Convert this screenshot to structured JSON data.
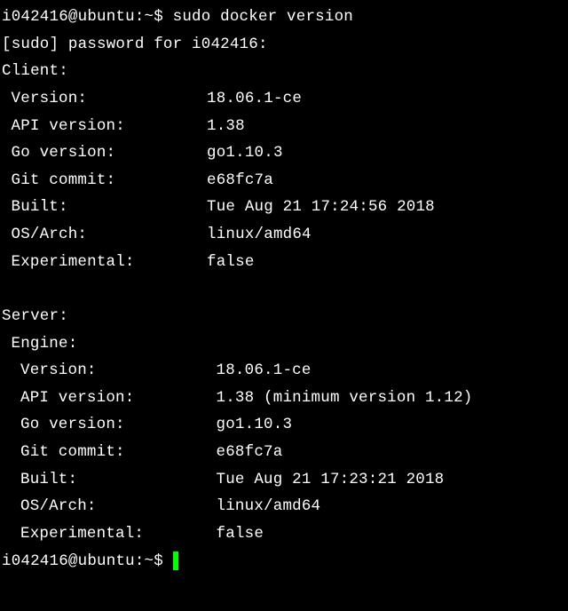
{
  "prompt1": {
    "userhost": "i042416@ubuntu",
    "sep": ":",
    "path": "~",
    "sigil": "$ ",
    "command": "sudo docker version"
  },
  "sudo_line": "[sudo] password for i042416:",
  "client": {
    "header": "Client:",
    "rows": [
      {
        "key": "Version:",
        "value": "18.06.1-ce"
      },
      {
        "key": "API version:",
        "value": "1.38"
      },
      {
        "key": "Go version:",
        "value": "go1.10.3"
      },
      {
        "key": "Git commit:",
        "value": "e68fc7a"
      },
      {
        "key": "Built:",
        "value": "Tue Aug 21 17:24:56 2018"
      },
      {
        "key": "OS/Arch:",
        "value": "linux/amd64"
      },
      {
        "key": "Experimental:",
        "value": "false"
      }
    ]
  },
  "server": {
    "header": "Server:",
    "engine_header": "Engine:",
    "rows": [
      {
        "key": "Version:",
        "value": "18.06.1-ce"
      },
      {
        "key": "API version:",
        "value": "1.38 (minimum version 1.12)"
      },
      {
        "key": "Go version:",
        "value": "go1.10.3"
      },
      {
        "key": "Git commit:",
        "value": "e68fc7a"
      },
      {
        "key": "Built:",
        "value": "Tue Aug 21 17:23:21 2018"
      },
      {
        "key": "OS/Arch:",
        "value": "linux/amd64"
      },
      {
        "key": "Experimental:",
        "value": "false"
      }
    ]
  },
  "prompt2": {
    "userhost": "i042416@ubuntu",
    "sep": ":",
    "path": "~",
    "sigil": "$ "
  }
}
